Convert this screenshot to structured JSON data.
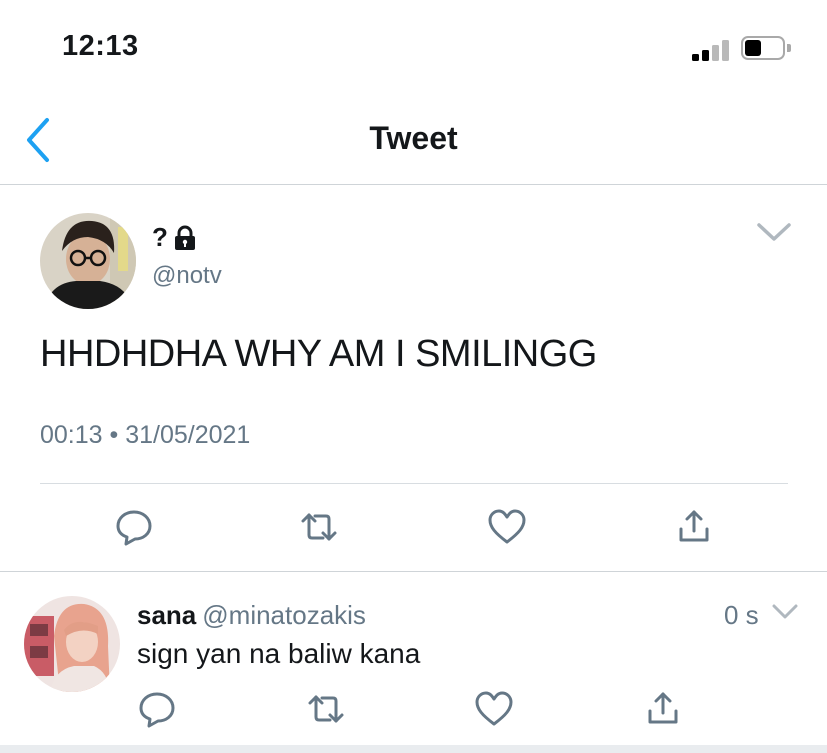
{
  "status_bar": {
    "time": "12:13"
  },
  "nav": {
    "title": "Tweet"
  },
  "tweet": {
    "display_name": "?",
    "handle": "@notv",
    "text": "HHDHDHA WHY AM I SMILINGG",
    "meta": "00:13 • 31/05/2021"
  },
  "reply": {
    "name": "sana",
    "handle": "@minatozakis",
    "time": "0 s",
    "text": "sign yan na baliw kana"
  },
  "icons": [
    "back-chevron-icon",
    "lock-icon",
    "chevron-down-icon",
    "reply-icon",
    "retweet-icon",
    "like-icon",
    "share-icon",
    "signal-icon",
    "battery-icon"
  ],
  "colors": {
    "accent": "#1da1f2",
    "icon_gray": "#657786",
    "text": "#14171a"
  }
}
